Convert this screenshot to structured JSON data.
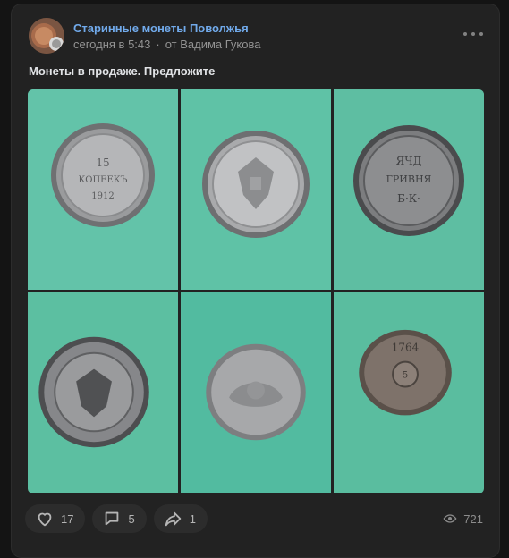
{
  "post": {
    "group_name": "Старинные монеты Поволжья",
    "date": "сегодня в 5:43",
    "separator": "·",
    "author": "от Вадима Гукова",
    "text": "Монеты в продаже. Предложите",
    "photos": [
      {
        "coin": "15 kopeks 1912 reverse"
      },
      {
        "coin": "double-headed eagle obverse"
      },
      {
        "coin": "grivna coin"
      },
      {
        "coin": "eagle coin with legend"
      },
      {
        "coin": "5 kopeks worn obverse"
      },
      {
        "coin": "5 kopeks reverse"
      }
    ]
  },
  "actions": {
    "likes": "17",
    "comments": "5",
    "shares": "1",
    "views": "721"
  },
  "icons": [
    "more-icon",
    "heart-icon",
    "comment-icon",
    "share-icon",
    "eye-icon"
  ],
  "colors": {
    "background": "#141414",
    "card": "#222222",
    "link": "#71aaeb",
    "photo_bg": "#5fbea3"
  }
}
